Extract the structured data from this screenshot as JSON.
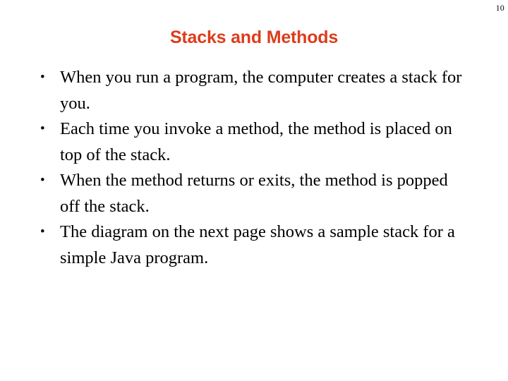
{
  "slide": {
    "page_number": "10",
    "title": "Stacks and Methods",
    "title_color": "#dd3c1c",
    "text_color": "#000000",
    "background_color": "#ffffff",
    "bullet_marker": "•",
    "bullets": [
      {
        "text": "When you run a program, the computer creates a stack for you."
      },
      {
        "text": "Each time you invoke a method, the method is placed on top of the stack."
      },
      {
        "text": "When the method returns or exits, the method is popped off the stack."
      },
      {
        "text": "The diagram on the next page shows a sample stack for a simple Java program."
      }
    ]
  }
}
